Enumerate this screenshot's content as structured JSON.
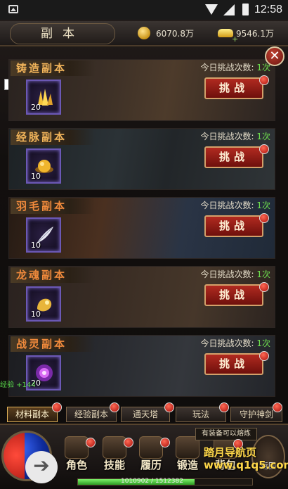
{
  "status_bar": {
    "time": "12:58"
  },
  "header": {
    "title": "副本",
    "gold": "6070.8万",
    "ingot": "9546.1万",
    "plus_sign": "+"
  },
  "dungeons": [
    {
      "name": "铸造副本",
      "tries_label": "今日挑战次数:",
      "tries": "1次",
      "count": "20",
      "button": "挑战"
    },
    {
      "name": "经脉副本",
      "tries_label": "今日挑战次数:",
      "tries": "1次",
      "count": "10",
      "button": "挑战"
    },
    {
      "name": "羽毛副本",
      "tries_label": "今日挑战次数:",
      "tries": "1次",
      "count": "10",
      "button": "挑战"
    },
    {
      "name": "龙魂副本",
      "tries_label": "今日挑战次数:",
      "tries": "1次",
      "count": "10",
      "button": "挑战"
    },
    {
      "name": "战灵副本",
      "tries_label": "今日挑战次数:",
      "tries": "1次",
      "count": "20",
      "button": "挑战"
    }
  ],
  "exp_popup": "经验 +144",
  "tabs": [
    {
      "label": "材料副本",
      "active": true
    },
    {
      "label": "经验副本"
    },
    {
      "label": "通天塔"
    },
    {
      "label": "玩法"
    },
    {
      "label": "守护神剑"
    }
  ],
  "bottom_menu": [
    {
      "label": "角色"
    },
    {
      "label": "技能"
    },
    {
      "label": "履历"
    },
    {
      "label": "锻造"
    },
    {
      "label": "背包"
    }
  ],
  "equip_tip": "有装备可以熔炼",
  "return_label": "返回",
  "exp_bar": {
    "text": "1010902 / 1512382",
    "fraction": 0.668
  },
  "watermark": {
    "line1": "踏月导航页",
    "line2": "www.q1q5.com"
  },
  "colors": {
    "accent_gold": "#f0b35a",
    "tries_green": "#6fe04f",
    "button_red": "#b12a20"
  }
}
